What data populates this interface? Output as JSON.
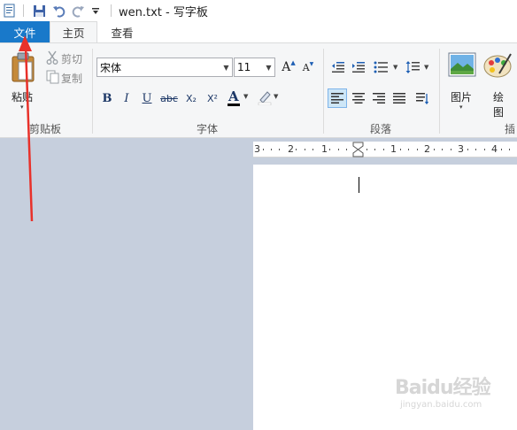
{
  "window": {
    "title": "wen.txt - 写字板",
    "quick_access": [
      "save-icon",
      "undo-icon",
      "redo-icon",
      "customize-dropdown-icon"
    ]
  },
  "tabs": [
    {
      "label": "文件",
      "active": false,
      "highlight": true
    },
    {
      "label": "主页",
      "active": true
    },
    {
      "label": "查看",
      "active": false
    }
  ],
  "ribbon": {
    "clipboard": {
      "group_label": "剪贴板",
      "paste_label": "粘贴",
      "cut_label": "剪切",
      "copy_label": "复制"
    },
    "font": {
      "group_label": "字体",
      "font_name": "宋体",
      "font_size": "11",
      "bold": "B",
      "italic": "I",
      "underline": "U",
      "strikethrough": "abc",
      "subscript": "X₂",
      "superscript": "X²",
      "font_color_letter": "A",
      "grow_glyph": "A",
      "shrink_glyph": "A"
    },
    "paragraph": {
      "group_label": "段落"
    },
    "insert": {
      "group_label": "插",
      "picture_label": "图片",
      "paint_label_1": "绘",
      "paint_label_2": "图"
    }
  },
  "ruler": {
    "labels": [
      "3",
      "2",
      "1",
      "1",
      "2",
      "3",
      "4"
    ]
  },
  "colors": {
    "file_tab": "#1979ca",
    "ribbon_bg": "#f5f6f7",
    "workspace_bg": "#c6cfdd",
    "annotation_arrow": "#e8312a"
  },
  "watermark": {
    "brand": "Baidu经验",
    "url": "jingyan.baidu.com"
  }
}
